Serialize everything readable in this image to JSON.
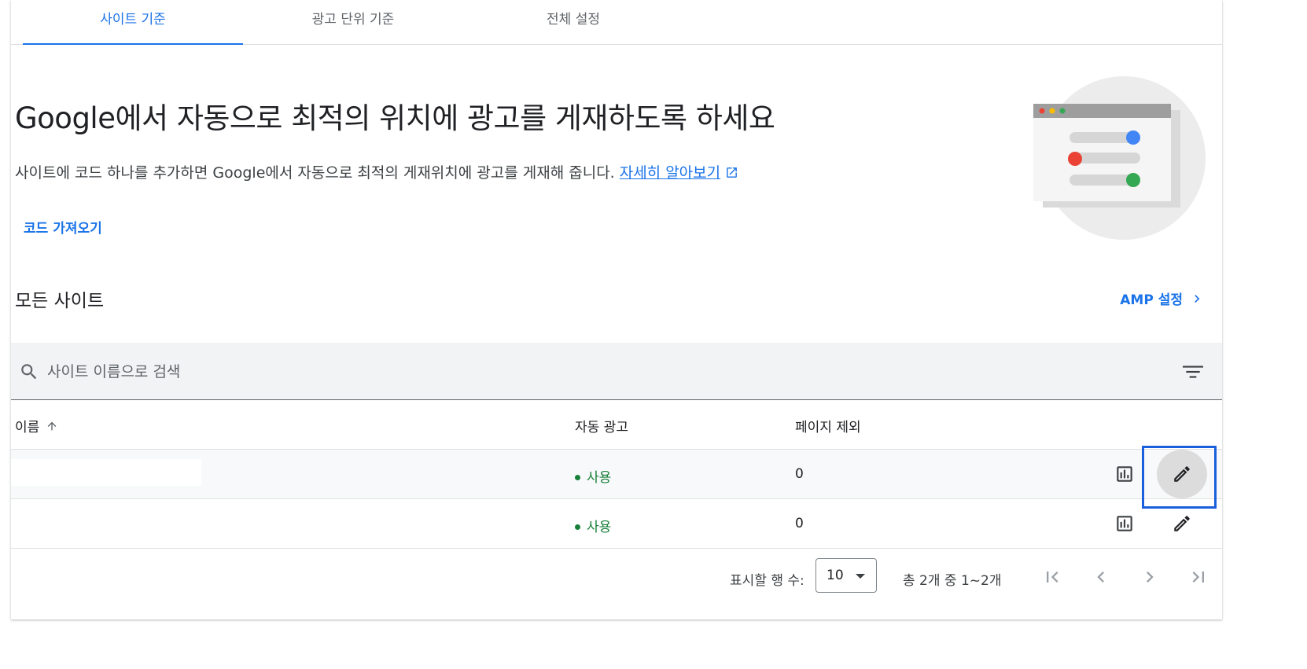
{
  "tabs": [
    {
      "label": "사이트 기준",
      "active": true
    },
    {
      "label": "광고 단위 기준",
      "active": false
    },
    {
      "label": "전체 설정",
      "active": false
    }
  ],
  "hero": {
    "headline": "Google에서 자동으로 최적의 위치에 광고를 게재하도록 하세요",
    "description": "사이트에 코드 하나를 추가하면 Google에서 자동으로 최적의 게재위치에 광고를 게재해 줍니다.",
    "learn_more": "자세히 알아보기",
    "get_code": "코드 가져오기"
  },
  "section": {
    "title": "모든 사이트",
    "amp_settings": "AMP 설정"
  },
  "search": {
    "placeholder": "사이트 이름으로 검색"
  },
  "table": {
    "headers": {
      "name": "이름",
      "auto_ads": "자동 광고",
      "page_exclusions": "페이지 제외"
    },
    "rows": [
      {
        "name": "",
        "auto_ads": "사용",
        "page_exclusions": "0"
      },
      {
        "name": "",
        "auto_ads": "사용",
        "page_exclusions": "0"
      }
    ]
  },
  "pagination": {
    "rows_per_page_label": "표시할 행 수:",
    "rows_per_page": "10",
    "range": "총 2개 중 1~2개"
  },
  "colors": {
    "accent": "#1a73e8",
    "status_green": "#188038",
    "highlight_border": "#1a5fdb"
  },
  "icons": {
    "search": "search-icon",
    "filter": "filter-icon",
    "sort": "arrow-up-icon",
    "report": "bar-chart-icon",
    "edit": "pencil-icon",
    "external": "open-in-new-icon",
    "chevron": "chevron-right-icon"
  }
}
